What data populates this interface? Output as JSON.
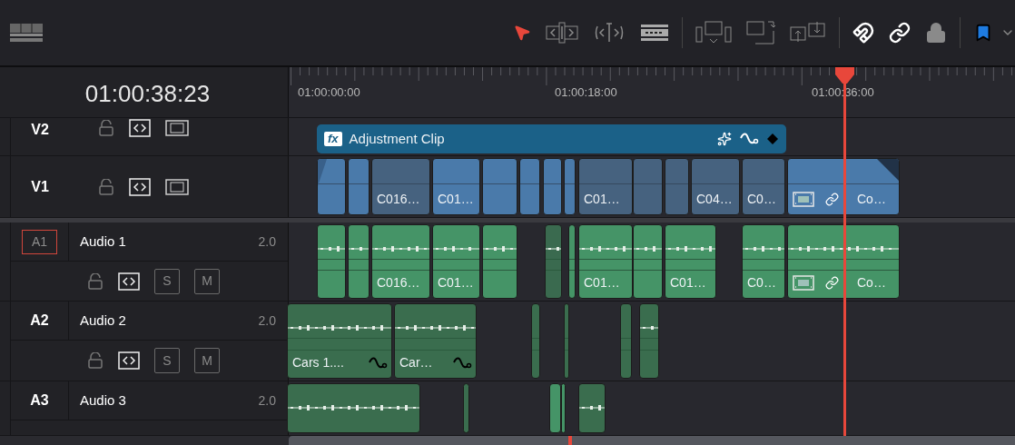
{
  "timecode": "01:00:38:23",
  "ruler": {
    "labels": [
      "01:00:00:00",
      "01:00:18:00",
      "01:00:36:00"
    ]
  },
  "toolbar": {
    "snapping": true,
    "linking": true,
    "position_lock": false
  },
  "video_tracks": [
    {
      "label": "V2",
      "clips": [
        {
          "label": "Adjustment Clip",
          "badge": "fx",
          "kind": "adjustment",
          "color": "#1b6188"
        }
      ]
    },
    {
      "label": "V1",
      "clips": [
        {
          "kind": "fade",
          "color": "#4a7aaa"
        },
        {
          "kind": "plain",
          "color": "#4a7aaa"
        },
        {
          "kind": "plain",
          "label": "C016…",
          "color": "#46627f"
        },
        {
          "kind": "plain",
          "label": "C01…",
          "color": "#4a7aaa"
        },
        {
          "kind": "plain",
          "color": "#4a7aaa"
        },
        {
          "kind": "plain",
          "color": "#4a7aaa"
        },
        {
          "kind": "plain",
          "color": "#4a7aaa"
        },
        {
          "kind": "plain",
          "color": "#4a7aaa"
        },
        {
          "kind": "plain",
          "label": "C01…",
          "color": "#46627f"
        },
        {
          "kind": "plain",
          "color": "#46627f"
        },
        {
          "kind": "plain",
          "color": "#46627f"
        },
        {
          "kind": "plain",
          "label": "C04…",
          "color": "#46627f"
        },
        {
          "kind": "plain",
          "label": "C0…",
          "color": "#46627f"
        },
        {
          "kind": "linked",
          "label": "Co…",
          "color": "#4a7aaa"
        }
      ]
    }
  ],
  "audio_tracks": [
    {
      "label": "A1",
      "name": "Audio 1",
      "format": "2.0",
      "selected": true,
      "solo": "S",
      "mute": "M",
      "clips": [
        {
          "kind": "plain",
          "color": "#459467"
        },
        {
          "kind": "plain",
          "color": "#459467"
        },
        {
          "kind": "plain",
          "label": "C016…",
          "color": "#459467"
        },
        {
          "kind": "plain",
          "label": "C01…",
          "color": "#459467"
        },
        {
          "kind": "plain",
          "color": "#459467"
        },
        {
          "kind": "plain",
          "color": "#3a6a4f"
        },
        {
          "kind": "plain",
          "color": "#459467"
        },
        {
          "kind": "plain",
          "label": "C01…",
          "color": "#459467"
        },
        {
          "kind": "plain",
          "color": "#459467"
        },
        {
          "kind": "plain",
          "label": "C01…",
          "color": "#459467"
        },
        {
          "kind": "plain",
          "label": "C0…",
          "color": "#459467"
        },
        {
          "kind": "linked",
          "label": "Co…",
          "color": "#459467"
        }
      ]
    },
    {
      "label": "A2",
      "name": "Audio 2",
      "format": "2.0",
      "selected": false,
      "solo": "S",
      "mute": "M",
      "clips": [
        {
          "kind": "curve",
          "label": "Cars 1....",
          "color": "#3a6d4e"
        },
        {
          "kind": "curve",
          "label": "Car…",
          "color": "#3a6d4e"
        },
        {
          "kind": "plain",
          "color": "#3a6d4e"
        },
        {
          "kind": "plain",
          "color": "#3a6d4e"
        },
        {
          "kind": "plain",
          "color": "#3a6d4e"
        },
        {
          "kind": "plain",
          "color": "#3a6d4e"
        }
      ]
    },
    {
      "label": "A3",
      "name": "Audio 3",
      "format": "2.0",
      "selected": false,
      "clips": [
        {
          "kind": "plain",
          "color": "#3a6d4e"
        },
        {
          "kind": "plain",
          "color": "#3a6d4e"
        },
        {
          "kind": "plain",
          "color": "#459467"
        },
        {
          "kind": "plain",
          "color": "#459467"
        },
        {
          "kind": "plain",
          "color": "#3a6d4e"
        }
      ]
    }
  ]
}
